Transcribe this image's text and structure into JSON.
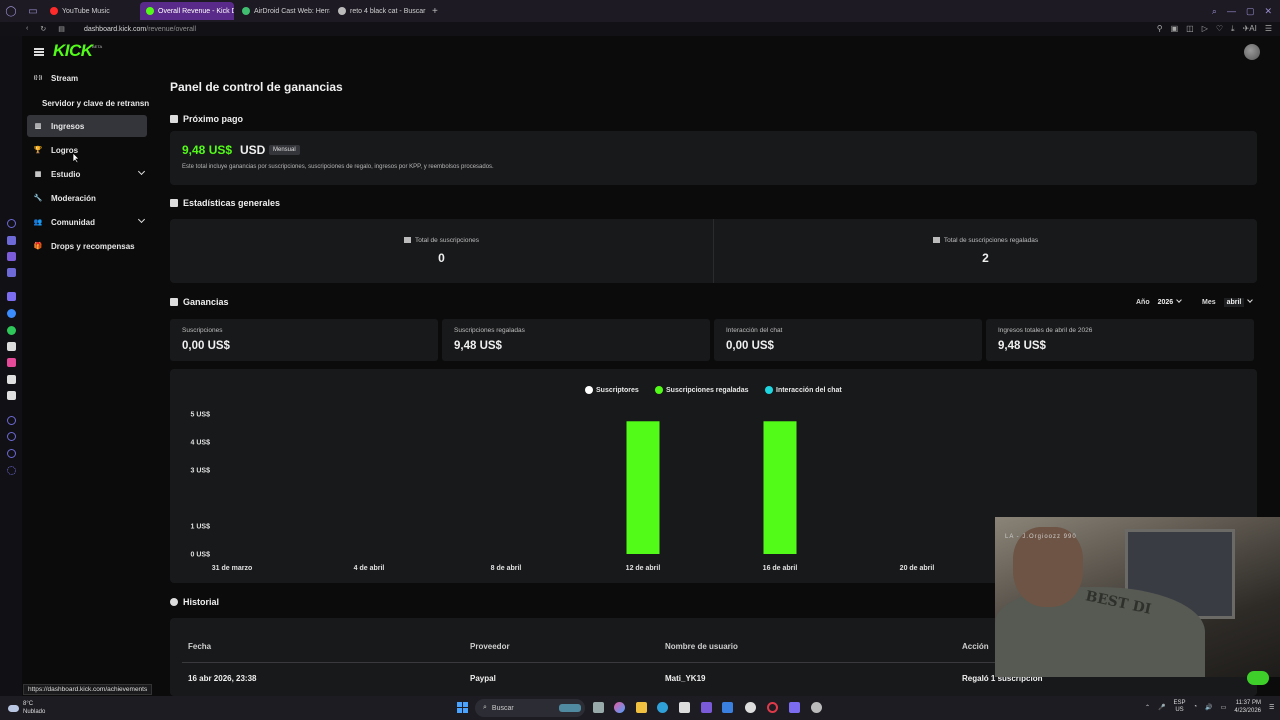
{
  "browser": {
    "tabs": [
      {
        "label": "YouTube Music",
        "color": "#ff2a2a",
        "active": false
      },
      {
        "label": "Overall Revenue - Kick D",
        "color": "#53fc18",
        "active": true
      },
      {
        "label": "AirDroid Cast Web: Herra",
        "color": "#3fbf6f",
        "active": false
      },
      {
        "label": "reto 4 black cat - Buscar c",
        "color": "#bbbbbb",
        "active": false
      }
    ],
    "new_tab": "+",
    "url_host": "dashboard.kick.com",
    "url_path": "/revenue/overall",
    "ai_label": "AI",
    "status_url": "https://dashboard.kick.com/achievements"
  },
  "logo": {
    "text": "KICK",
    "beta": "BETA"
  },
  "sidebar": {
    "items": [
      {
        "label": "Stream",
        "icon": "broadcast-icon",
        "glyph": "((·))"
      },
      {
        "label": "Servidor y clave de retransn",
        "sub": true
      },
      {
        "label": "Ingresos",
        "icon": "chart-icon",
        "glyph": "▥",
        "active": true
      },
      {
        "label": "Logros",
        "icon": "trophy-icon",
        "glyph": "🏆"
      },
      {
        "label": "Estudio",
        "icon": "studio-icon",
        "glyph": "▦",
        "chevron": true
      },
      {
        "label": "Moderación",
        "icon": "wrench-icon",
        "glyph": "🔧"
      },
      {
        "label": "Comunidad",
        "icon": "community-icon",
        "glyph": "👥",
        "chevron": true
      },
      {
        "label": "Drops y recompensas",
        "icon": "gift-icon",
        "glyph": "🎁"
      }
    ]
  },
  "main": {
    "title": "Panel de control de ganancias",
    "next_payment": {
      "heading": "Próximo pago",
      "amount": "9,48 US$",
      "currency": "USD",
      "badge": "Mensual",
      "description": "Este total incluye ganancias por suscripciones, suscripciones de regalo, ingresos por KPP, y reembolsos procesados."
    },
    "stats": {
      "heading": "Estadísticas generales",
      "total_subs_label": "Total de suscripciones",
      "total_subs_value": "0",
      "total_gifted_label": "Total de suscripciones regaladas",
      "total_gifted_value": "2"
    },
    "earnings": {
      "heading": "Ganancias",
      "year_label": "Año",
      "year_value": "2026",
      "month_label": "Mes",
      "month_value": "abril",
      "metrics": [
        {
          "label": "Suscripciones",
          "value": "0,00 US$"
        },
        {
          "label": "Suscripciones regaladas",
          "value": "9,48 US$"
        },
        {
          "label": "Interacción del chat",
          "value": "0,00 US$"
        },
        {
          "label": "Ingresos totales de abril de 2026",
          "value": "9,48 US$"
        }
      ]
    },
    "history": {
      "heading": "Historial",
      "columns": [
        "Fecha",
        "Proveedor",
        "Nombre de usuario",
        "Acción"
      ],
      "rows": [
        [
          "16 abr 2026, 23:38",
          "Paypal",
          "Mati_YK19",
          "Regaló 1 suscripción"
        ]
      ]
    }
  },
  "chart_data": {
    "type": "bar",
    "categories": [
      "31 de marzo",
      "4 de abril",
      "8 de abril",
      "12 de abril",
      "16 de abril",
      "20 de abril"
    ],
    "series": [
      {
        "name": "Suscriptores",
        "color": "#ffffff",
        "values": [
          0,
          0,
          0,
          0,
          0,
          0
        ]
      },
      {
        "name": "Suscripciones regaladas",
        "color": "#53fc18",
        "values": [
          0,
          0,
          0,
          4.74,
          4.74,
          0
        ]
      },
      {
        "name": "Interacción del chat",
        "color": "#1fd6e0",
        "values": [
          0,
          0,
          0,
          0,
          0,
          0
        ]
      }
    ],
    "yticks": [
      "0 US$",
      "1 US$",
      "3 US$",
      "4 US$",
      "5 US$"
    ],
    "ytick_values": [
      0,
      1,
      3,
      4,
      5
    ],
    "ylim": [
      0,
      5
    ],
    "legend": "top-center",
    "grid": false
  },
  "webcam": {
    "overlay_text": "LA - J.Orgioozz 990",
    "shirt_text": "BEST DI"
  },
  "taskbar": {
    "weather_temp": "8°C",
    "weather_desc": "Nublado",
    "search_label": "Buscar",
    "lang_top": "ESP",
    "lang_bottom": "US",
    "time": "11:37 PM",
    "date": "4/23/2026"
  },
  "colors": {
    "accent": "#53fc18",
    "bg": "#0b0b0c",
    "card": "#18191b"
  }
}
